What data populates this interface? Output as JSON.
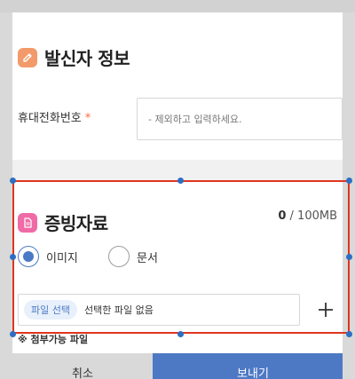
{
  "sender_section": {
    "title": "발신자 정보",
    "phone_label": "휴대전화번호",
    "required_mark": "*",
    "phone_placeholder": "- 제외하고 입력하세요."
  },
  "evidence_section": {
    "title": "증빙자료",
    "size_used": "0",
    "size_limit": " / 100MB",
    "radio_options": [
      {
        "label": "이미지",
        "checked": true
      },
      {
        "label": "문서",
        "checked": false
      }
    ],
    "file_button": "파일 선택",
    "file_status": "선택한 파일 없음",
    "allowed_files_label": "※ 첨부가능 파일"
  },
  "actions": {
    "cancel": "취소",
    "send": "보내기"
  },
  "colors": {
    "accent_blue": "#4d78c4",
    "required_orange": "#ff6d3a",
    "selection_red": "#e0351f",
    "badge_orange": "#f39a6a",
    "badge_pink": "#f06aa6"
  },
  "icons": {
    "sender_badge": "edit-icon",
    "evidence_badge": "document-icon",
    "add": "plus-icon"
  }
}
